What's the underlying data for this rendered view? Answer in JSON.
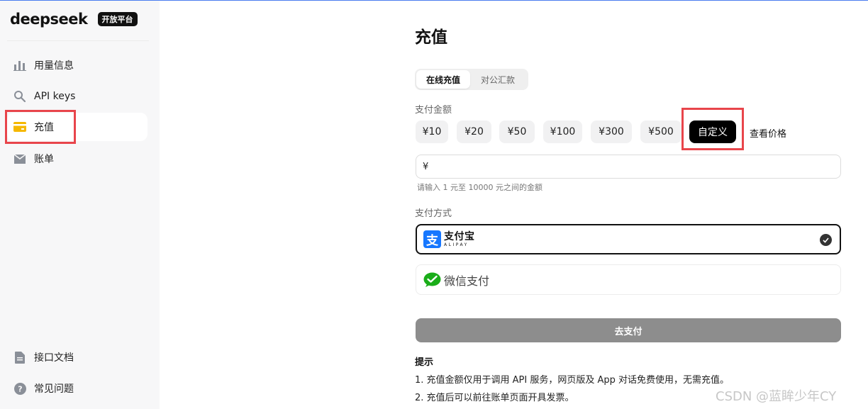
{
  "brand": {
    "name": "deepseek",
    "badge": "开放平台"
  },
  "sidebar": {
    "items": [
      {
        "label": "用量信息",
        "icon": "bar-chart-icon"
      },
      {
        "label": "API keys",
        "icon": "search-key-icon"
      },
      {
        "label": "充值",
        "icon": "credit-card-icon",
        "active": true
      },
      {
        "label": "账单",
        "icon": "bill-icon"
      }
    ],
    "bottom_items": [
      {
        "label": "接口文档",
        "icon": "document-icon"
      },
      {
        "label": "常见问题",
        "icon": "help-icon"
      }
    ]
  },
  "main": {
    "title": "充值",
    "tabs": [
      {
        "label": "在线充值",
        "active": true
      },
      {
        "label": "对公汇款",
        "active": false
      }
    ],
    "amount_label": "支付金额",
    "amounts": [
      "¥10",
      "¥20",
      "¥50",
      "¥100",
      "¥300",
      "¥500",
      "自定义"
    ],
    "selected_amount": "自定义",
    "price_link": "查看价格",
    "input": {
      "currency": "¥",
      "value": "",
      "hint": "请输入 1 元至 10000 元之间的金额"
    },
    "method_label": "支付方式",
    "methods": {
      "alipay": {
        "cn": "支付宝",
        "en": "ALIPAY",
        "selected": true
      },
      "wechat": {
        "label": "微信支付",
        "selected": false
      }
    },
    "pay_button": "去支付",
    "tips": {
      "title": "提示",
      "items": [
        "1. 充值金额仅用于调用 API 服务，网页版及 App 对话免费使用，无需充值。",
        "2. 充值后可以前往账单页面开具发票。"
      ]
    }
  },
  "watermark": "CSDN @蓝眸少年CY",
  "colors": {
    "highlight": "#e8454b",
    "accent_card": "#f5b800",
    "alipay": "#1677ff",
    "wechat": "#1aad19"
  }
}
